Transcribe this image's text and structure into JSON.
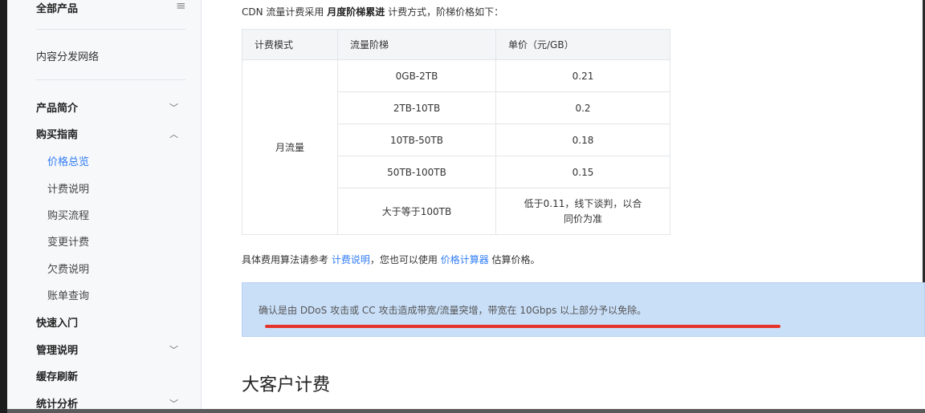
{
  "sidebar": {
    "top_title": "全部产品",
    "section": "内容分发网络",
    "items": [
      {
        "label": "产品简介",
        "chevron": "﹀"
      },
      {
        "label": "购买指南",
        "chevron": "︿"
      },
      {
        "label": "快速入门"
      },
      {
        "label": "管理说明",
        "chevron": "﹀"
      },
      {
        "label": "缓存刷新"
      },
      {
        "label": "统计分析",
        "chevron": "﹀"
      }
    ],
    "subitems": [
      "价格总览",
      "计费说明",
      "购买流程",
      "变更计费",
      "欠费说明",
      "账单查询"
    ],
    "active_subitem": "价格总览"
  },
  "intro": {
    "prefix": "CDN 流量计费采用",
    "bold": "月度阶梯累进",
    "suffix": "计费方式，阶梯价格如下："
  },
  "table": {
    "headers": [
      "计费模式",
      "流量阶梯",
      "单价（元/GB）"
    ],
    "mode": "月流量",
    "rows": [
      {
        "tier": "0GB-2TB",
        "price": "0.21"
      },
      {
        "tier": "2TB-10TB",
        "price": "0.2"
      },
      {
        "tier": "10TB-50TB",
        "price": "0.18"
      },
      {
        "tier": "50TB-100TB",
        "price": "0.15"
      },
      {
        "tier": "大于等于100TB",
        "price_line1": "低于0.11，线下谈判，以合",
        "price_line2": "同价为准"
      }
    ]
  },
  "note": {
    "prefix": "具体费用算法请参考",
    "link1": "计费说明",
    "middle": "，您也可以使用",
    "link2": "价格计算器",
    "suffix": "估算价格。"
  },
  "banner": {
    "text": "确认是由 DDoS 攻击或 CC 攻击造成带宽/流量突增，带宽在 10Gbps 以上部分予以免除。"
  },
  "section_heading": "大客户计费",
  "colors": {
    "link": "#2f7cf6",
    "banner_bg": "#c9dff8",
    "annotation": "#e5332a"
  }
}
